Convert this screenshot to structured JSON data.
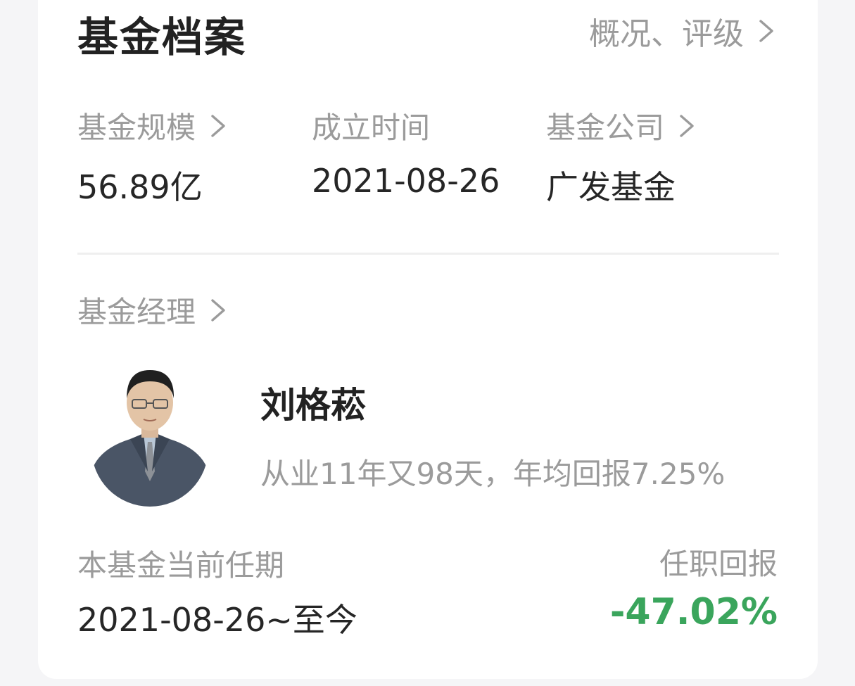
{
  "header": {
    "title": "基金档案",
    "overview_link": "概况、评级"
  },
  "stats": [
    {
      "label": "基金规模",
      "value": "56.89亿",
      "has_arrow": true
    },
    {
      "label": "成立时间",
      "value": "2021-08-26",
      "has_arrow": false
    },
    {
      "label": "基金公司",
      "value": "广发基金",
      "has_arrow": true
    }
  ],
  "manager_section": {
    "label": "基金经理",
    "name": "刘格菘",
    "info": "从业11年又98天，年均回报7.25%",
    "avatar_icon": "manager-portrait"
  },
  "tenure": {
    "label": "本基金当前任期",
    "value": "2021-08-26~至今",
    "return_label": "任职回报",
    "return_value": "-47.02%"
  },
  "colors": {
    "negative_return": "#3aa55c",
    "title": "#222222",
    "secondary": "#9b9b9b"
  }
}
